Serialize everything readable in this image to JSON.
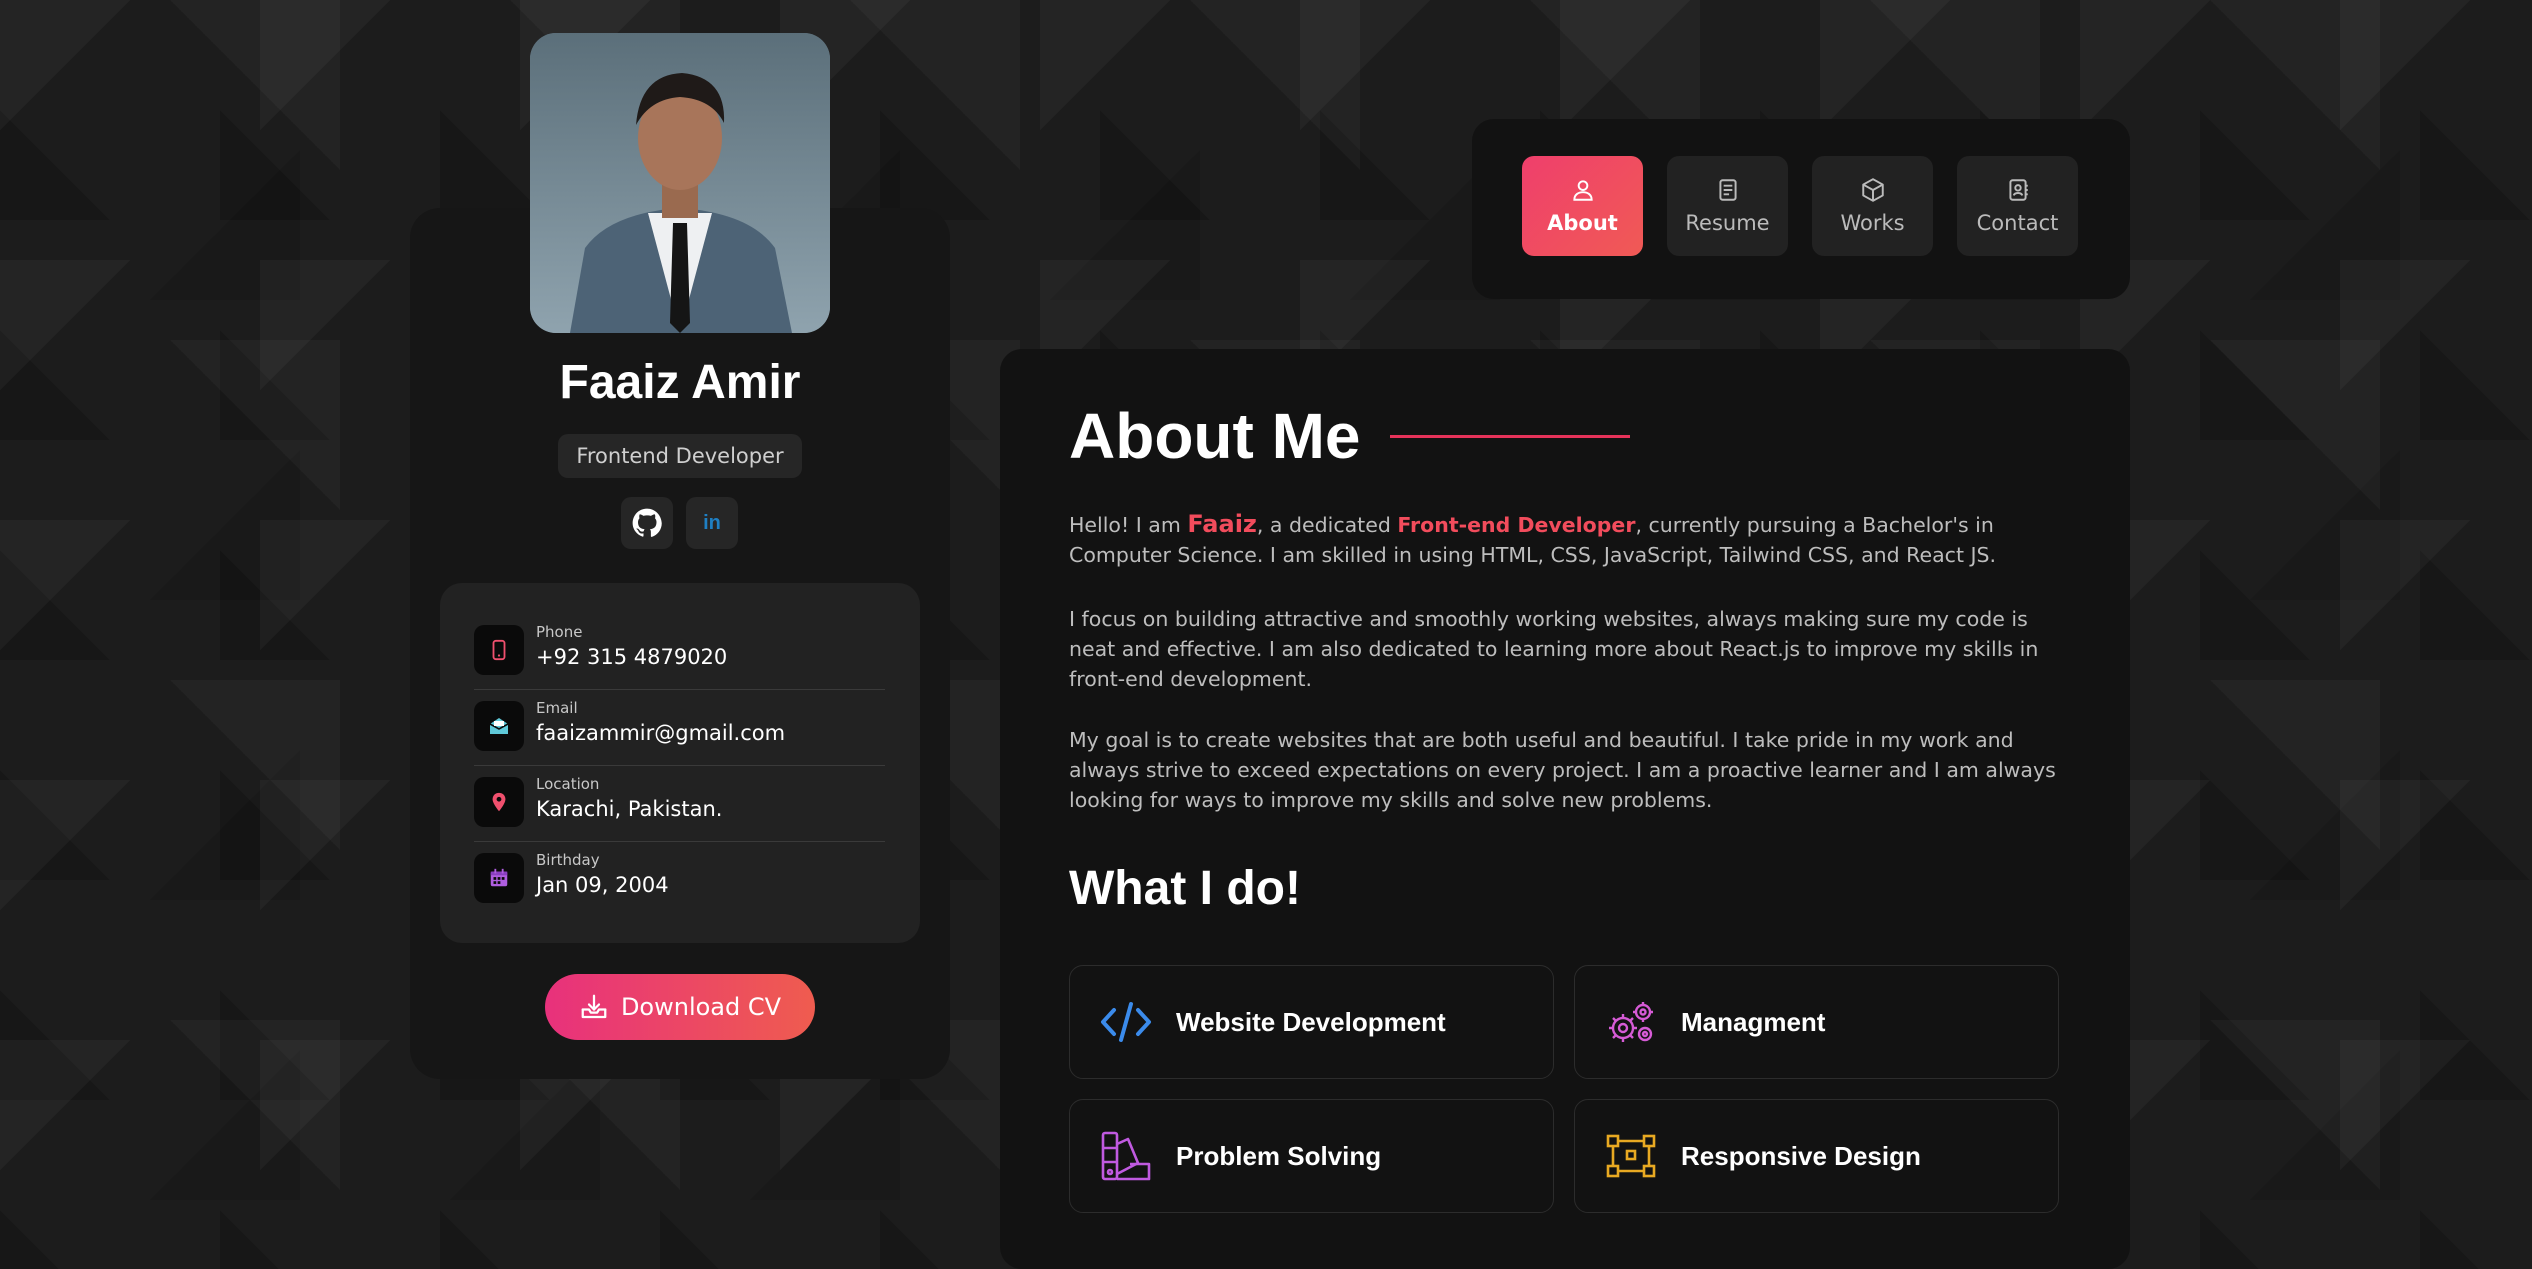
{
  "profile": {
    "name": "Faaiz Amir",
    "role": "Frontend Developer",
    "social": [
      {
        "icon": "github-icon"
      },
      {
        "icon": "linkedin-icon",
        "glyph": "in"
      }
    ],
    "contacts": [
      {
        "label": "Phone",
        "value": "+92 315 4879020",
        "icon": "phone-icon",
        "color": "#f0506e"
      },
      {
        "label": "Email",
        "value": "faaizammir@gmail.com",
        "icon": "mail-icon",
        "color": "#5fc9d9"
      },
      {
        "label": "Location",
        "value": "Karachi, Pakistan.",
        "icon": "location-pin-icon",
        "color": "#f0506e"
      },
      {
        "label": "Birthday",
        "value": "Jan 09, 2004",
        "icon": "calendar-icon",
        "color": "#b05ee0"
      }
    ],
    "download_label": "Download CV"
  },
  "nav": {
    "items": [
      {
        "label": "About",
        "icon": "user-icon",
        "active": true
      },
      {
        "label": "Resume",
        "icon": "document-icon",
        "active": false
      },
      {
        "label": "Works",
        "icon": "cube-icon",
        "active": false
      },
      {
        "label": "Contact",
        "icon": "address-book-icon",
        "active": false
      }
    ]
  },
  "about": {
    "title": "About Me",
    "p1": {
      "pre": "Hello! I am ",
      "name": "Faaiz",
      "mid": ", a dedicated ",
      "role": "Front-end Developer",
      "post": ", currently pursuing a Bachelor's in Computer Science. I am skilled in using HTML, CSS, JavaScript, Tailwind CSS, and React JS."
    },
    "p2": "I focus on building attractive and smoothly working websites, always making sure my code is neat and effective. I am also dedicated to learning more about React.js to improve my skills in front-end development.",
    "p3": "My goal is to create websites that are both useful and beautiful. I take pride in my work and always strive to exceed expectations on every project. I am a proactive learner and I am always looking for ways to improve my skills and solve new problems."
  },
  "services": {
    "title": "What I do!",
    "items": [
      {
        "label": "Website Development",
        "icon": "code-icon",
        "color": "#3b8beb"
      },
      {
        "label": "Managment",
        "icon": "gears-icon",
        "color": "#d65bd6"
      },
      {
        "label": "Problem Solving",
        "icon": "swatches-icon",
        "color": "#c05ae0"
      },
      {
        "label": "Responsive Design",
        "icon": "vector-frame-icon",
        "color": "#e8a922"
      }
    ]
  },
  "colors": {
    "accent": "#f24c5c",
    "panel": "#121212"
  }
}
